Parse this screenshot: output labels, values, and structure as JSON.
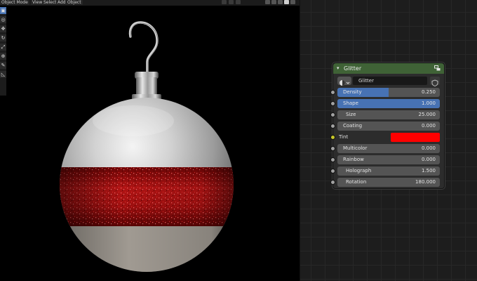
{
  "viewport": {
    "header": {
      "mode": "Object Mode",
      "menus": [
        "View",
        "Select",
        "Add",
        "Object"
      ]
    },
    "tools": [
      "select-box-icon",
      "cursor-icon",
      "move-icon",
      "rotate-icon",
      "scale-icon",
      "transform-icon",
      "annotate-icon",
      "measure-icon"
    ]
  },
  "node": {
    "title": "Glitter",
    "header_color": "#3f6236",
    "group_name": "Glitter",
    "inputs": [
      {
        "label": "Density",
        "value": "0.250",
        "fill": 0.5
      },
      {
        "label": "Shape",
        "value": "1.000",
        "fill": 1.0
      },
      {
        "label": "Size",
        "value": "25.000"
      },
      {
        "label": "Coating",
        "value": "0.000"
      },
      {
        "label": "Tint",
        "color": "#ff0000"
      },
      {
        "label": "Multicolor",
        "value": "0.000"
      },
      {
        "label": "Rainbow",
        "value": "0.000"
      },
      {
        "label": "Holograph",
        "value": "1.500"
      },
      {
        "label": "Rotation",
        "value": "180.000"
      }
    ]
  },
  "colors": {
    "accent": "#4772b3",
    "field": "#545454",
    "socket_float": "#a1a1a1",
    "socket_color": "#c7c729",
    "tint": "#ff0000"
  }
}
